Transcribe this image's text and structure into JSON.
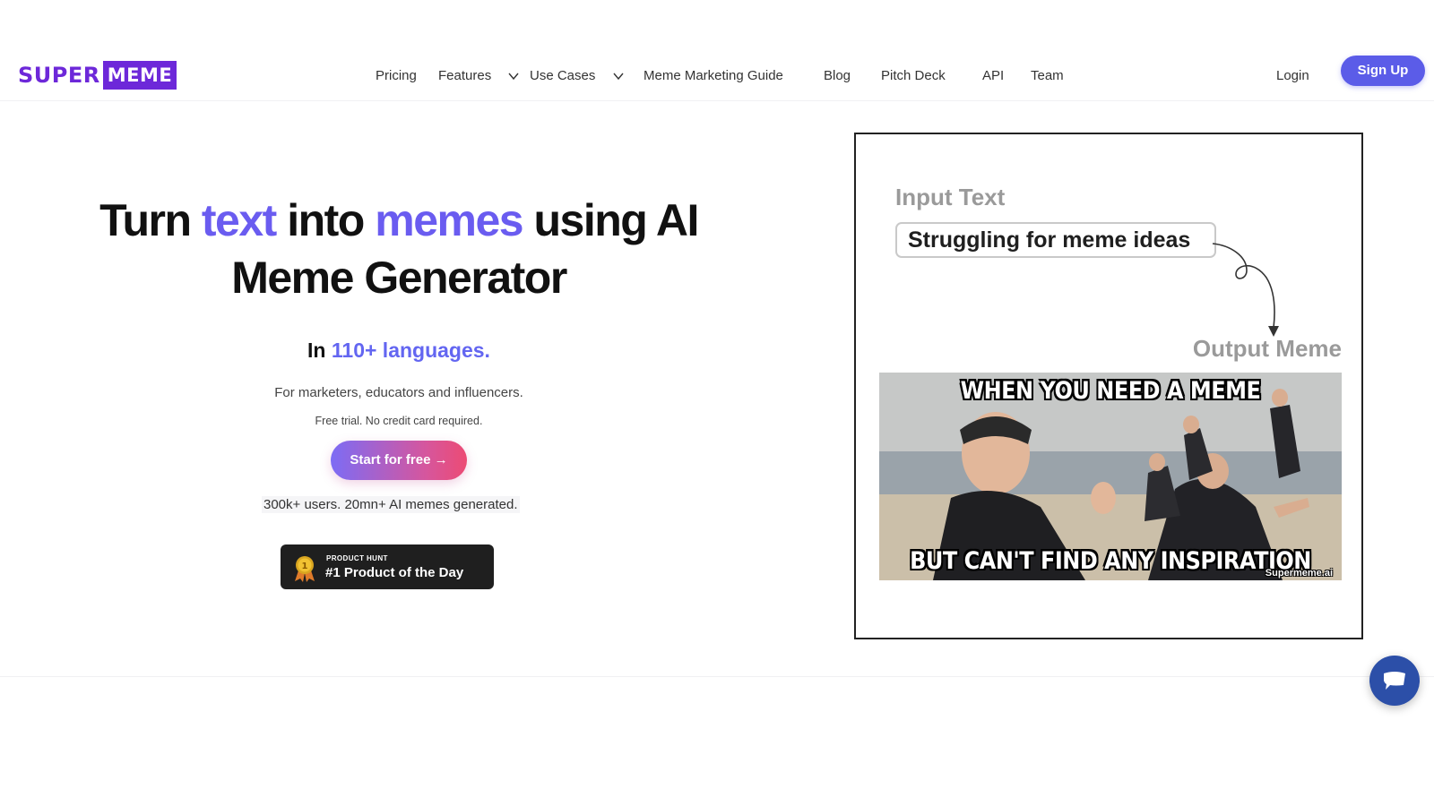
{
  "brand": {
    "logo_super": "SUPER",
    "logo_meme": "MEME",
    "color": "#6d28d9"
  },
  "nav": {
    "items": [
      {
        "label": "Pricing",
        "dropdown": false
      },
      {
        "label": "Features",
        "dropdown": true
      },
      {
        "label": "Use Cases",
        "dropdown": true
      },
      {
        "label": "Meme Marketing Guide",
        "dropdown": false
      },
      {
        "label": "Blog",
        "dropdown": false
      },
      {
        "label": "Pitch Deck",
        "dropdown": false
      },
      {
        "label": "API",
        "dropdown": false
      },
      {
        "label": "Team",
        "dropdown": false
      }
    ],
    "login_label": "Login",
    "signup_label": "Sign Up"
  },
  "hero": {
    "title_1": "Turn ",
    "title_accent_1": "text",
    "title_2": " into ",
    "title_accent_2": "memes",
    "title_3": " using AI Meme Generator",
    "languages_prefix": "In ",
    "languages_accent": "110+ languages.",
    "audience": "For marketers, educators and influencers.",
    "trial": "Free trial. No credit card required.",
    "cta_label": "Start for free →",
    "stats": "300k+ users. 20mn+ AI memes generated.",
    "accent_color": "#6a5cf0"
  },
  "product_hunt": {
    "small_label": "PRODUCT HUNT",
    "big_label": "#1 Product of the Day",
    "medal_number": "1"
  },
  "demo": {
    "input_label": "Input Text",
    "input_value": "Struggling for meme ideas",
    "output_label": "Output Meme",
    "meme_top_text": "WHEN YOU NEED A MEME",
    "meme_bottom_text": "BUT CAN'T FIND ANY INSPIRATION",
    "meme_watermark": "Supermeme.ai"
  },
  "chat": {
    "icon": "chat-bubble-icon",
    "color": "#2c4fa8"
  }
}
